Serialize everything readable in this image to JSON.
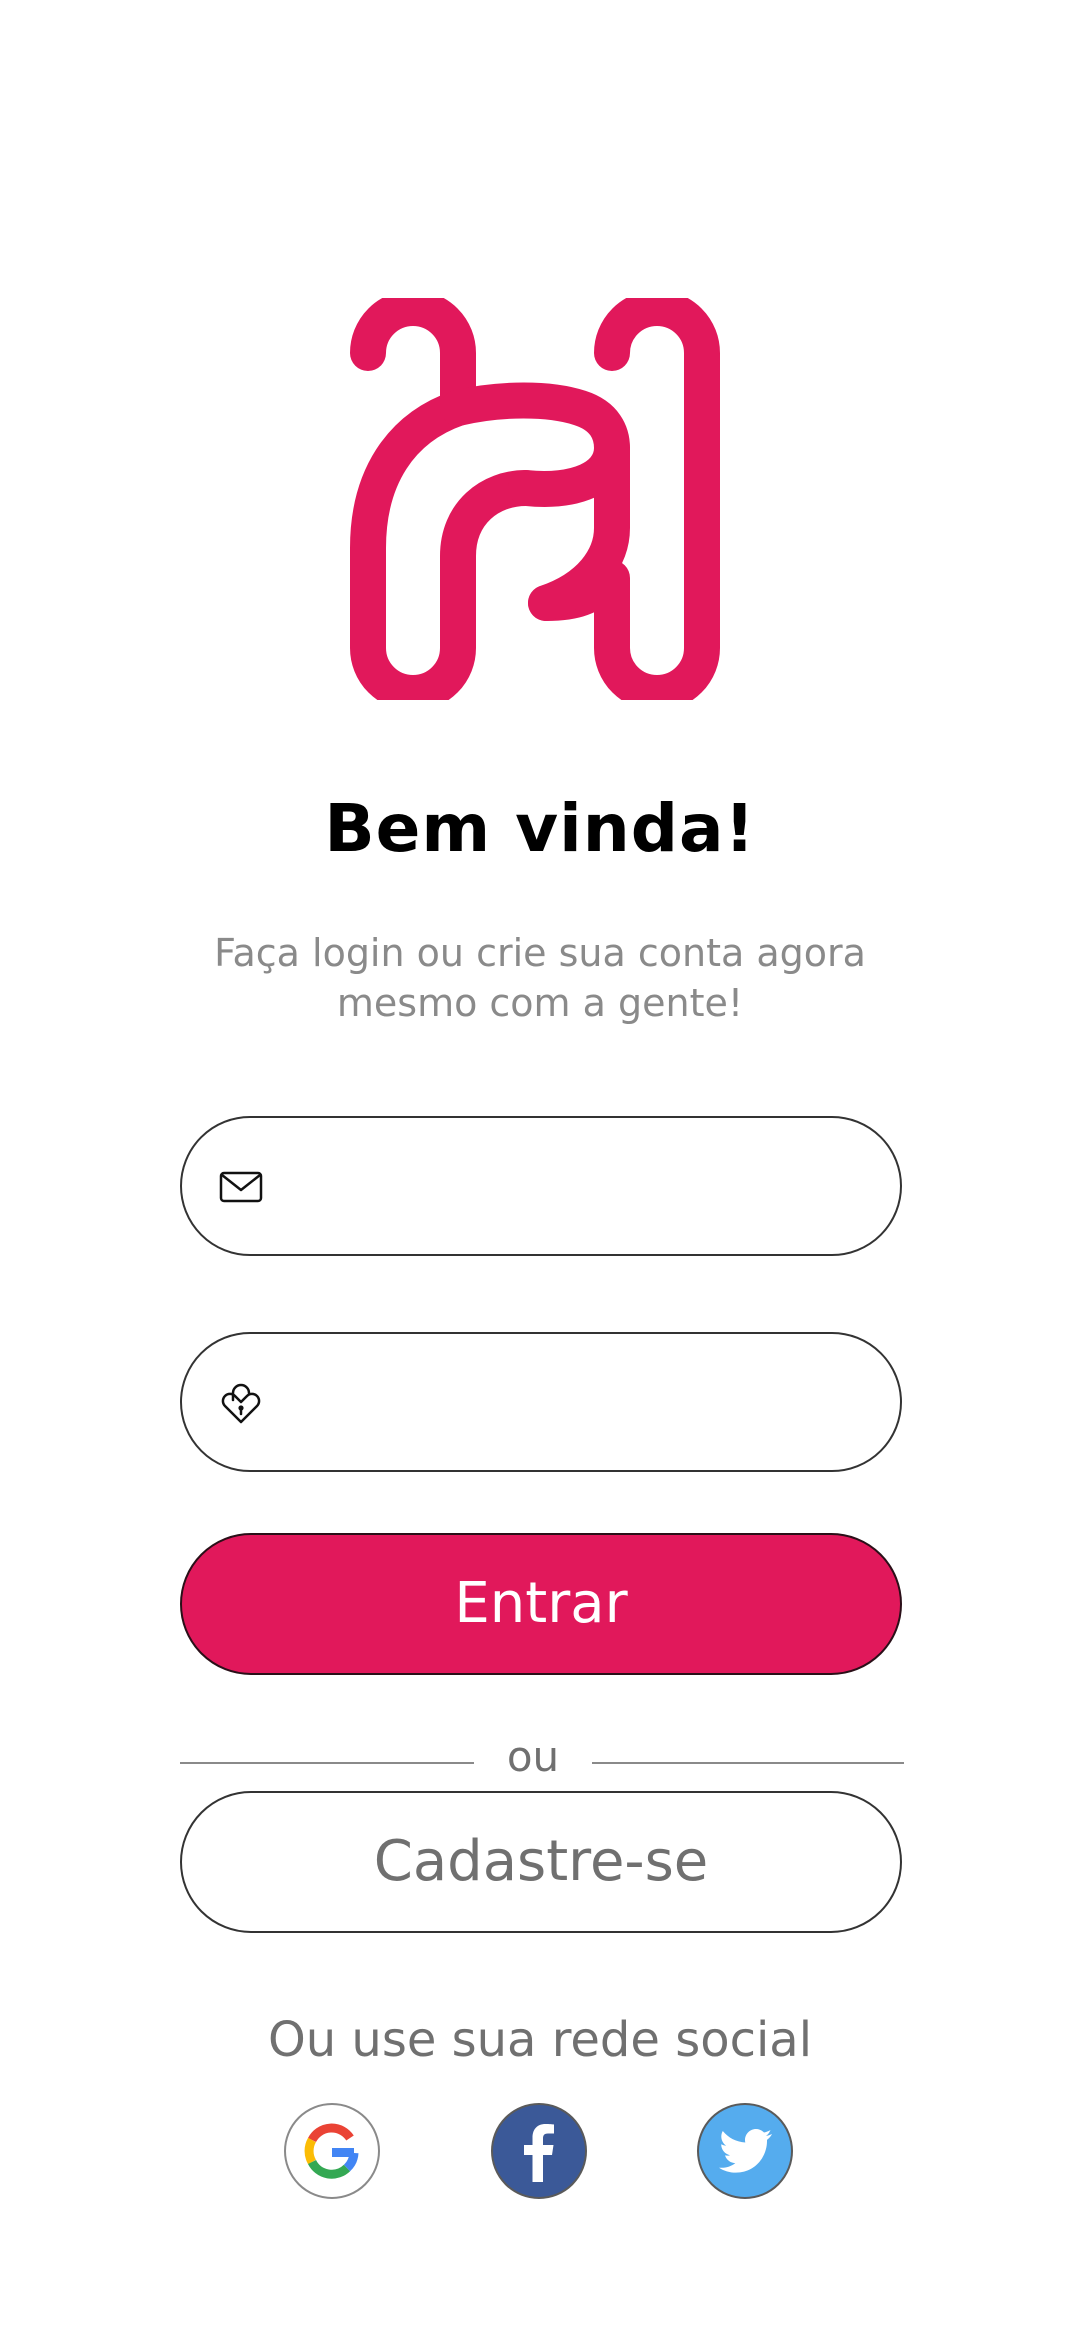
{
  "brand": {
    "logo_icon": "h-logo-icon",
    "accent_color": "#e1185b"
  },
  "welcome": {
    "title": "Bem vinda!",
    "subtitle_line1": "Faça login ou crie sua conta agora",
    "subtitle_line2": "mesmo com a gente!"
  },
  "form": {
    "email": {
      "icon": "envelope-icon",
      "value": "",
      "placeholder": ""
    },
    "password": {
      "icon": "heart-lock-icon",
      "value": "",
      "placeholder": ""
    },
    "login_label": "Entrar",
    "divider_label": "ou",
    "signup_label": "Cadastre-se"
  },
  "social": {
    "label": "Ou use sua rede social",
    "providers": [
      {
        "name": "google",
        "icon": "google-icon"
      },
      {
        "name": "facebook",
        "icon": "facebook-icon",
        "color": "#3b5998"
      },
      {
        "name": "twitter",
        "icon": "twitter-icon",
        "color": "#55acee"
      }
    ]
  }
}
